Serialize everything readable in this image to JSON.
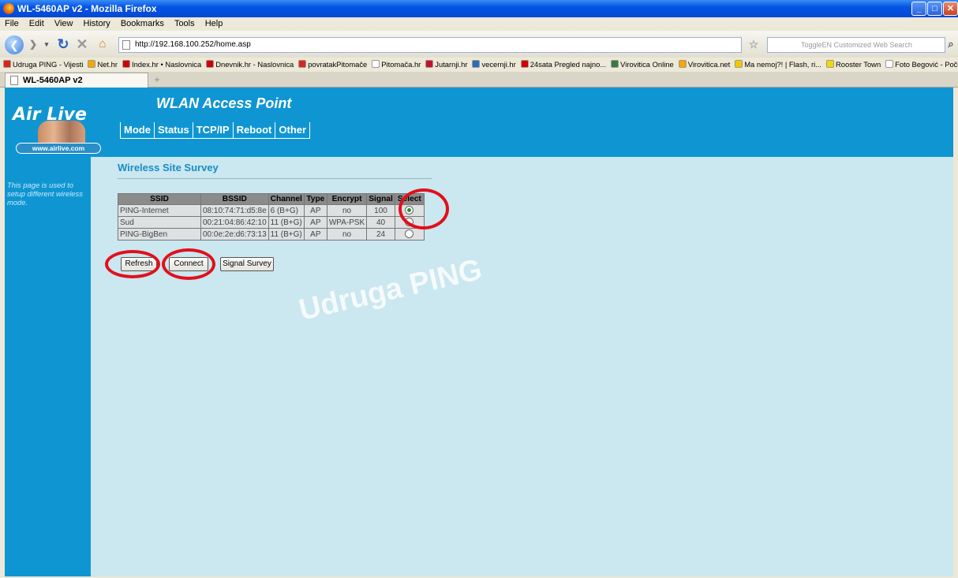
{
  "window": {
    "title": "WL-5460AP v2 - Mozilla Firefox",
    "controls": [
      "_",
      "□",
      "✕"
    ]
  },
  "menu": [
    "File",
    "Edit",
    "View",
    "History",
    "Bookmarks",
    "Tools",
    "Help"
  ],
  "nav": {
    "url": "http://192.168.100.252/home.asp",
    "search_placeholder": "ToggleEN Customized Web Search"
  },
  "bookmarks": [
    {
      "label": "Udruga PING - Vijesti",
      "color": "#d9261c"
    },
    {
      "label": "Net.hr",
      "color": "#f6a700"
    },
    {
      "label": "Index.hr • Naslovnica",
      "color": "#d40000"
    },
    {
      "label": "Dnevnik.hr - Naslovnica",
      "color": "#d40000"
    },
    {
      "label": "povratakPitomače",
      "color": "#d9261c"
    },
    {
      "label": "Pitomača.hr",
      "color": "#ffffff"
    },
    {
      "label": "Jutarnji.hr",
      "color": "#c8102e"
    },
    {
      "label": "vecernji.hr",
      "color": "#2a6db5"
    },
    {
      "label": "24sata Pregled najno...",
      "color": "#d40000"
    },
    {
      "label": "Virovitica Online",
      "color": "#3b7a3b"
    },
    {
      "label": "Virovitica.net",
      "color": "#f6a700"
    },
    {
      "label": "Ma nemoj?! | Flash, ri...",
      "color": "#f6c700"
    },
    {
      "label": "Rooster Town",
      "color": "#f6d800"
    },
    {
      "label": "Foto Begović - Početna",
      "color": "#ffffff"
    }
  ],
  "tab": {
    "title": "WL-5460AP v2",
    "new_tab": "+"
  },
  "logo": {
    "brand": "Air Live",
    "url": "www.airlive.com"
  },
  "header": {
    "title": "WLAN Access Point",
    "tabs": [
      "Mode",
      "Status",
      "TCP/IP",
      "Reboot",
      "Other"
    ]
  },
  "sidebar": {
    "text": "This page is used to setup different wireless mode."
  },
  "page": {
    "title": "Wireless Site Survey"
  },
  "table": {
    "headers": [
      "SSID",
      "BSSID",
      "Channel",
      "Type",
      "Encrypt",
      "Signal",
      "Select"
    ],
    "rows": [
      {
        "ssid": "PING-Internet",
        "bssid": "08:10:74:71:d5:8e",
        "channel": "6 (B+G)",
        "type": "AP",
        "encrypt": "no",
        "signal": "100",
        "selected": true
      },
      {
        "ssid": "Sud",
        "bssid": "00:21:04:86:42:10",
        "channel": "11 (B+G)",
        "type": "AP",
        "encrypt": "WPA-PSK",
        "signal": "40",
        "selected": false
      },
      {
        "ssid": "PING-BigBen",
        "bssid": "00:0e:2e:d6:73:13",
        "channel": "11 (B+G)",
        "type": "AP",
        "encrypt": "no",
        "signal": "24",
        "selected": false
      }
    ]
  },
  "buttons": {
    "refresh": "Refresh",
    "connect": "Connect",
    "signal_survey": "Signal Survey"
  },
  "watermark": "Udruga PING",
  "annotation_color": "#e0101c"
}
